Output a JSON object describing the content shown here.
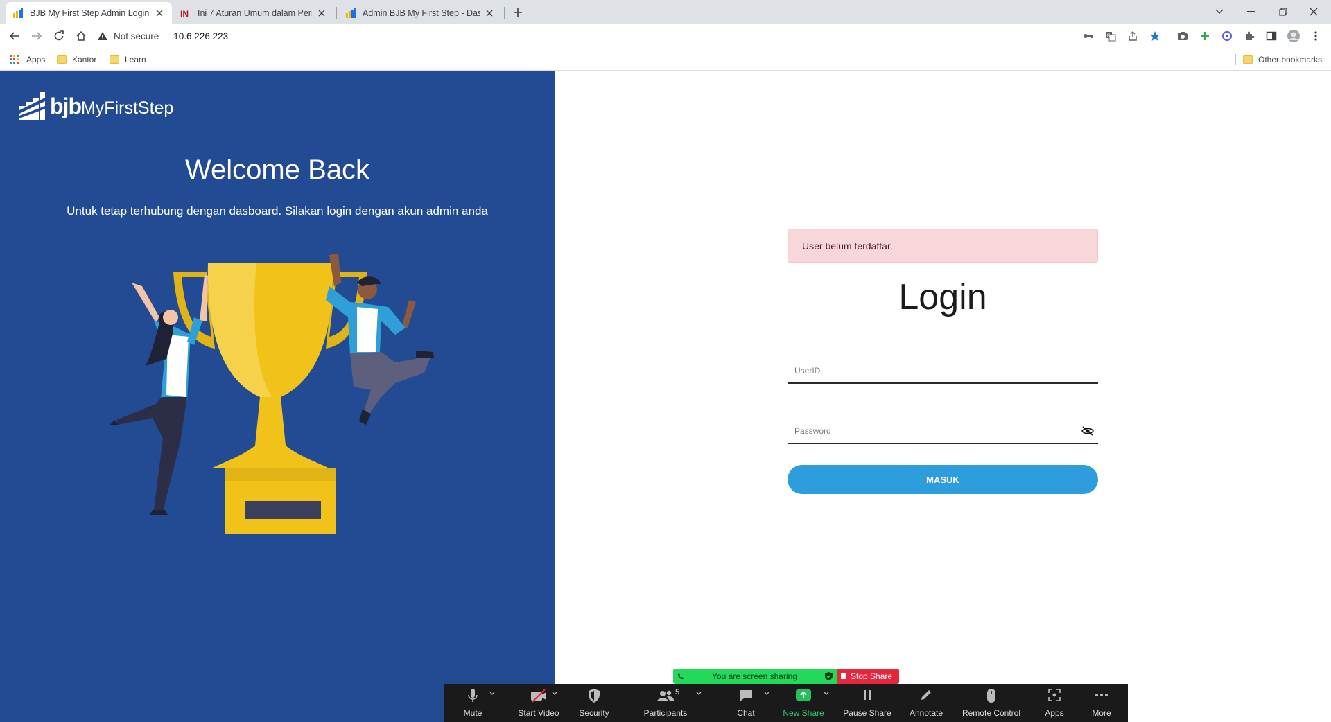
{
  "browser": {
    "tabs": [
      {
        "title": "BJB My First Step Admin Login",
        "active": true
      },
      {
        "title": "Ini 7 Aturan Umum dalam Perma",
        "active": false
      },
      {
        "title": "Admin BJB My First Step - Dashb",
        "active": false
      }
    ],
    "security_label": "Not secure",
    "url": "10.6.226.223",
    "bookmarks": {
      "apps": "Apps",
      "kantor": "Kantor",
      "learn": "Learn",
      "other": "Other bookmarks"
    }
  },
  "left_panel": {
    "logo_bold": "bjb",
    "logo_rest": "MyFirstStep",
    "heading": "Welcome Back",
    "subtitle": "Untuk tetap terhubung dengan dasboard. Silakan login dengan akun admin anda"
  },
  "login": {
    "alert": "User belum terdaftar.",
    "title": "Login",
    "userid_placeholder": "UserID",
    "password_placeholder": "Password",
    "submit_label": "MASUK"
  },
  "zoom": {
    "sharing_text": "You are screen sharing",
    "stop_share": "Stop Share",
    "buttons": {
      "mute": "Mute",
      "start_video": "Start Video",
      "security": "Security",
      "participants": "Participants",
      "participant_count": "5",
      "chat": "Chat",
      "new_share": "New Share",
      "pause_share": "Pause Share",
      "annotate": "Annotate",
      "remote_control": "Remote Control",
      "apps": "Apps",
      "more": "More"
    }
  },
  "colors": {
    "left_bg": "#224b93",
    "button_blue": "#2d9ddd",
    "alert_bg": "#f8d7da",
    "trophy": "#f1c31a"
  }
}
